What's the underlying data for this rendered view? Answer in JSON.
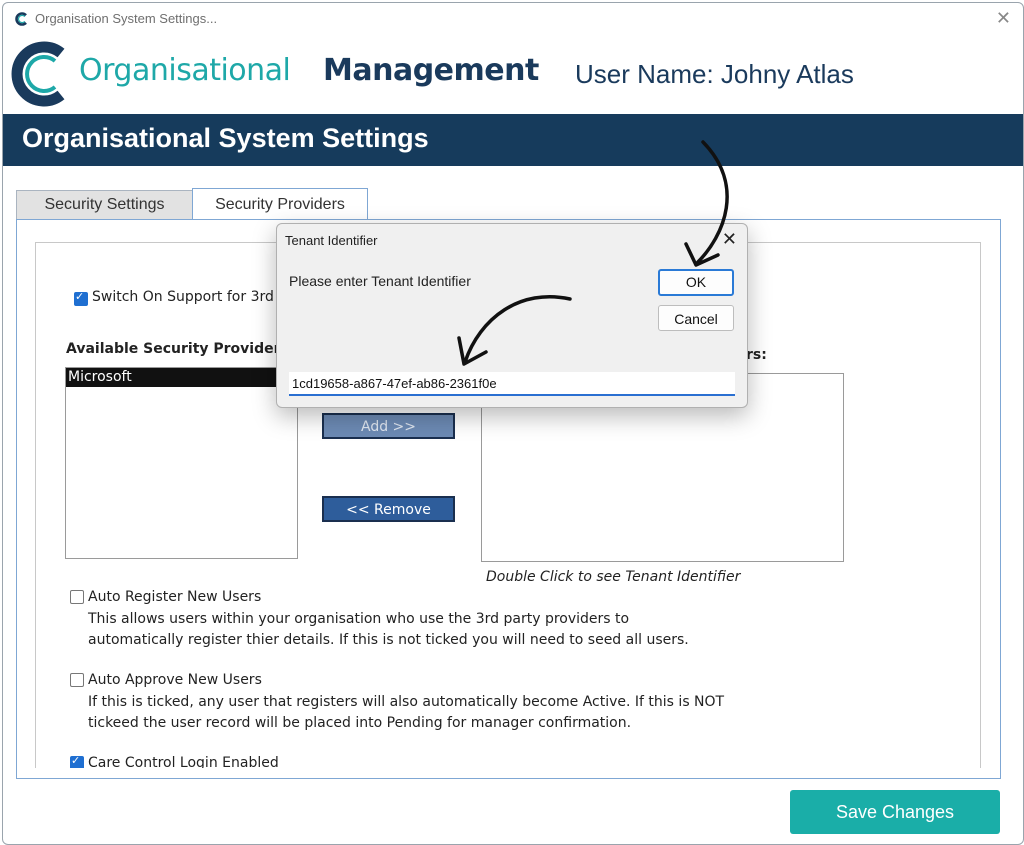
{
  "window": {
    "title": "Organisation System Settings..."
  },
  "brand": {
    "name_part1": "Organisational",
    "name_part2": "Management",
    "user_label": "User Name: Johny Atlas"
  },
  "banner": {
    "title": "Organisational System Settings"
  },
  "tabs": [
    {
      "label": "Security Settings",
      "selected": false
    },
    {
      "label": "Security Providers",
      "selected": true
    }
  ],
  "panel": {
    "switch_support_label": "Switch On Support for 3rd",
    "switch_support_checked": true,
    "available_heading": "Available Security Providers:",
    "available_items": [
      "Microsoft"
    ],
    "selected_heading_tail": "rs:",
    "add_button": "Add >>",
    "remove_button": "<< Remove",
    "double_click_hint": "Double Click to see Tenant Identifier",
    "auto_register": {
      "label": "Auto Register New Users",
      "checked": false,
      "desc_line1": "This allows users within your organisation who use the 3rd party providers to",
      "desc_line2": "automatically register thier details.  If this is not ticked you will need to seed all users."
    },
    "auto_approve": {
      "label": "Auto Approve New Users",
      "checked": false,
      "desc_line1": "If this is ticked, any user that registers will also automatically become Active.  If this is NOT",
      "desc_line2": "tickeed the user record will be placed into Pending for manager confirmation."
    },
    "care_control": {
      "label": "Care Control Login Enabled",
      "checked": true
    }
  },
  "footer": {
    "save_label": "Save Changes"
  },
  "dialog": {
    "title": "Tenant Identifier",
    "prompt": "Please enter Tenant Identifier",
    "ok_label": "OK",
    "cancel_label": "Cancel",
    "input_value": "1cd19658-a867-47ef-ab86-2361f0e"
  },
  "colors": {
    "brand_teal": "#1ea8a8",
    "brand_navy": "#1a3a5c",
    "banner": "#163b5c",
    "save_button": "#1aaea8",
    "nav_button": "#2e5d9b"
  },
  "icons": {
    "app": "app-logo-icon",
    "close": "close-icon",
    "dialog_close": "close-icon"
  }
}
